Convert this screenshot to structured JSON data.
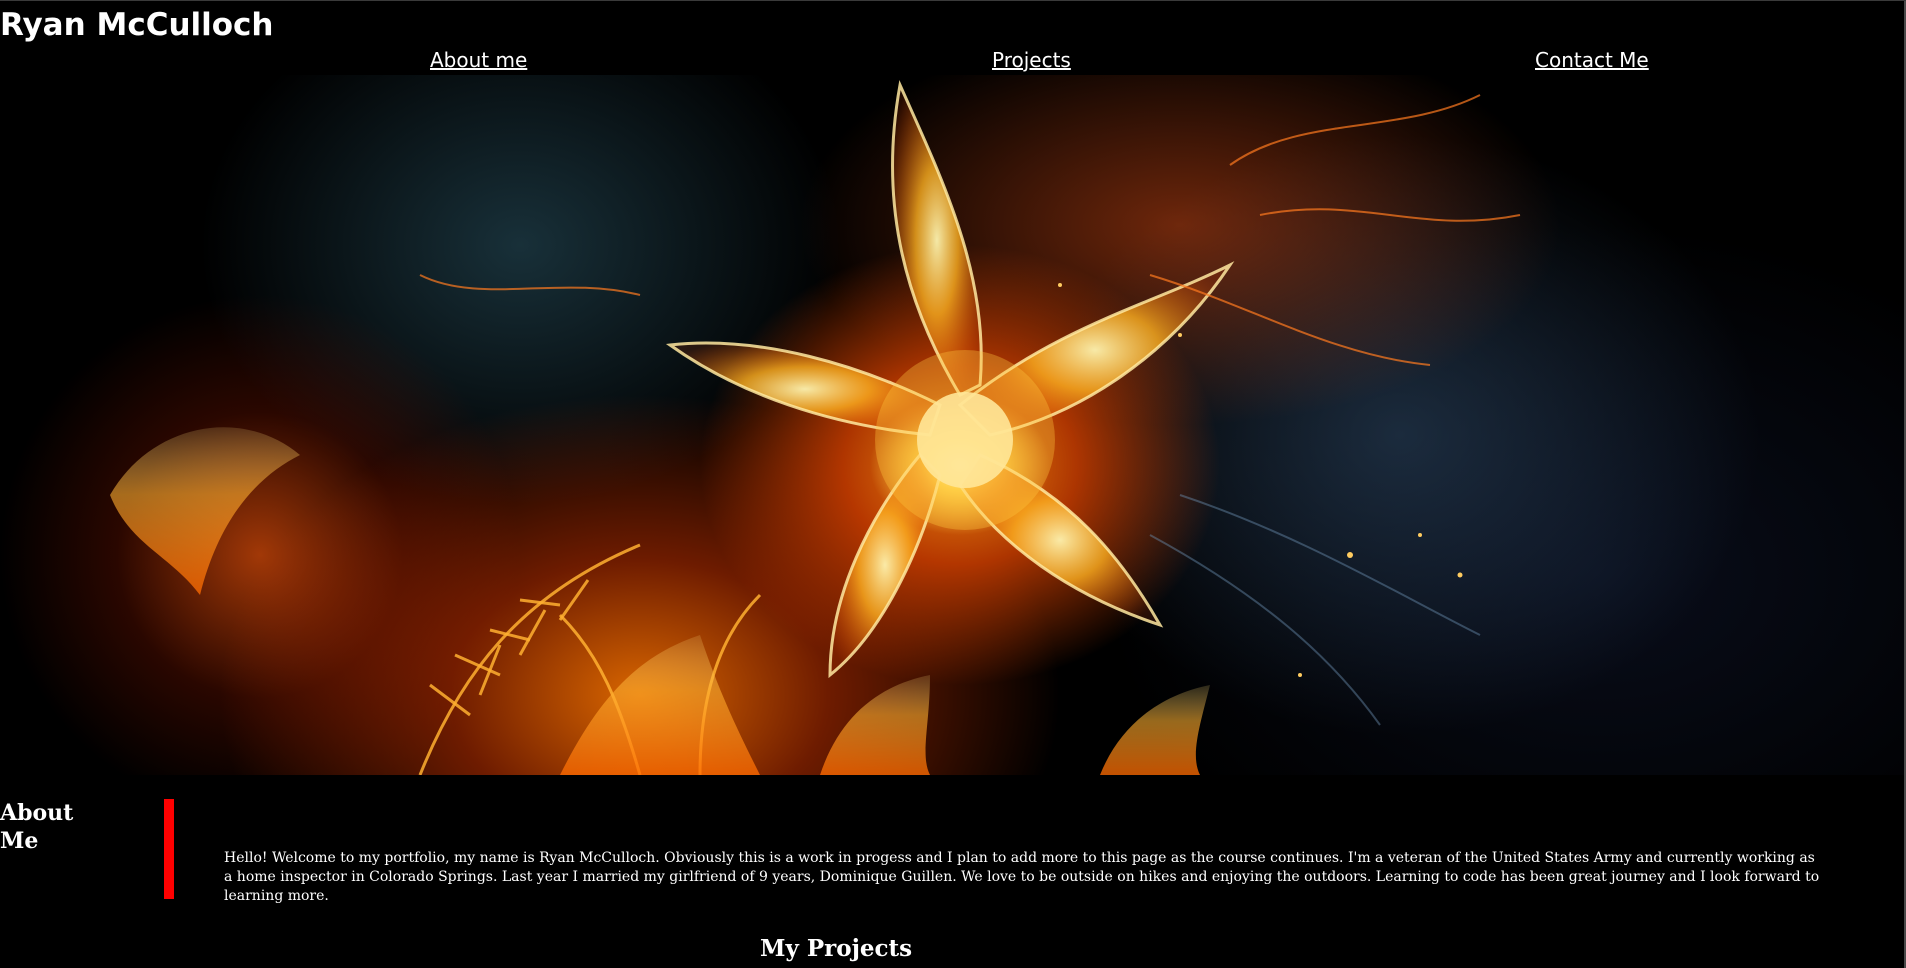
{
  "header": {
    "site_title": "Ryan McCulloch"
  },
  "nav": {
    "items": [
      {
        "label": "About me"
      },
      {
        "label": "Projects"
      },
      {
        "label": "Contact Me"
      }
    ]
  },
  "hero": {
    "image": "fire-flower-image"
  },
  "about": {
    "heading": "About Me",
    "body": "Hello! Welcome to my portfolio, my name is Ryan McCulloch. Obviously this is a work in progess and I plan to add more to this page as the course continues. I'm a veteran of the United States Army and currently working as a home inspector in Colorado Springs. Last year I married my girlfriend of 9 years, Dominique Guillen. We love to be outside on hikes and enjoying the outdoors. Learning to code has been great journey and I look forward to learning more.",
    "accent_color": "#ff0000"
  },
  "projects": {
    "heading": "My Projects"
  },
  "colors": {
    "background": "#000000",
    "text": "#ffffff"
  }
}
